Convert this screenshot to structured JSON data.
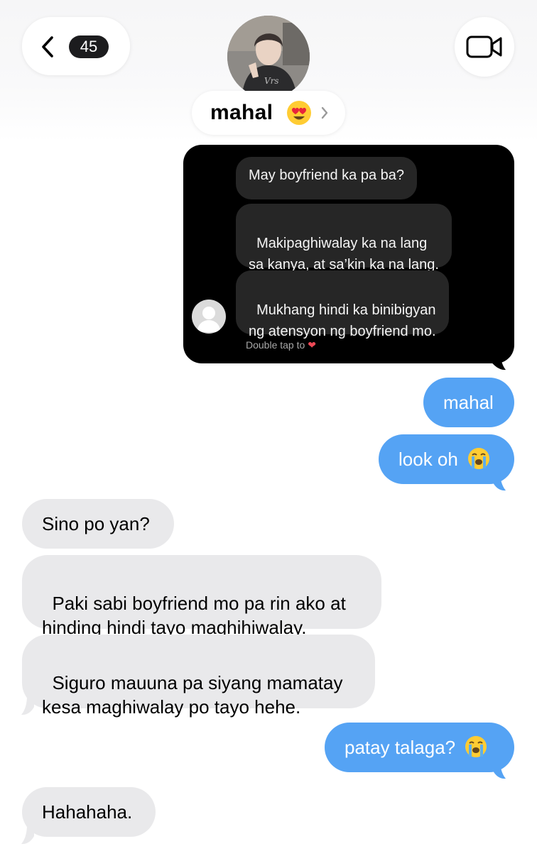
{
  "header": {
    "back_count": "45",
    "contact_name": "mahal",
    "contact_emoji": "heart-eyes-emoji"
  },
  "shared_screenshot": {
    "messages": [
      "May boyfriend ka pa ba?",
      "Makipaghiwalay ka na lang\nsa kanya, at sa’kin ka na lang.",
      "Mukhang hindi ka binibigyan\nng atensyon ng boyfriend mo."
    ],
    "footer": "Double tap to"
  },
  "conversation": [
    {
      "from": "me",
      "text": "mahal"
    },
    {
      "from": "me",
      "text": "look oh"
    },
    {
      "from": "them",
      "text": "Sino po yan?"
    },
    {
      "from": "them",
      "text": "Paki sabi boyfriend mo pa rin ako at\nhinding hindi tayo maghihiwalay."
    },
    {
      "from": "them",
      "text": "Siguro mauuna pa siyang mamatay\nkesa maghiwalay po tayo hehe."
    },
    {
      "from": "me",
      "text": "patay talaga?"
    },
    {
      "from": "them",
      "text": "Hahahaha."
    }
  ],
  "colors": {
    "sent_bubble": "#55a3f4",
    "received_bubble": "#e9e9eb",
    "screenshot_bg": "#000000",
    "screenshot_bubble": "#262626"
  }
}
